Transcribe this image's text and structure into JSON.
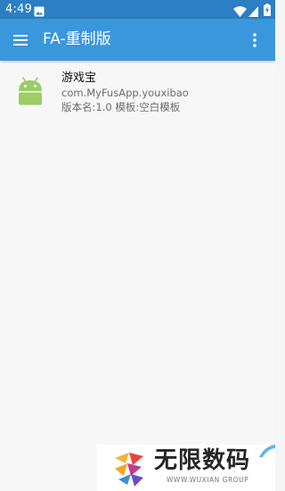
{
  "colors": {
    "status_bar": "#2c7fc2",
    "app_bar": "#3a97dc",
    "background": "#f7f7f7",
    "android_green": "#9ccc65"
  },
  "status_bar": {
    "time": "4:49",
    "icons": [
      "image-notification-icon",
      "wifi-icon",
      "signal-icon",
      "battery-icon"
    ]
  },
  "app_bar": {
    "title": "FA-重制版",
    "menu_icon": "hamburger-menu-icon",
    "more_icon": "more-vert-icon"
  },
  "projects": [
    {
      "icon": "android-robot-icon",
      "name": "游戏宝",
      "package": "com.MyFusApp.youxibao",
      "meta": "版本名:1.0  模板:空白模板"
    }
  ],
  "watermark": {
    "title": "无限数码",
    "subtitle": "WWW.WUXIAN GROUP"
  }
}
